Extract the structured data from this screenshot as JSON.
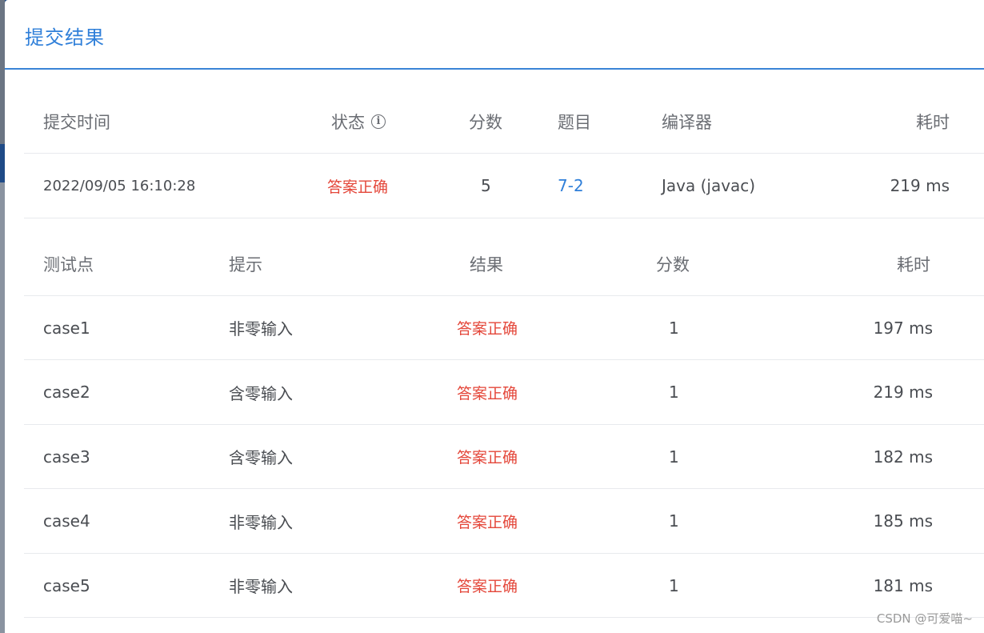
{
  "dialog": {
    "title": "提交结果"
  },
  "submission_table": {
    "headers": {
      "time": "提交时间",
      "status": "状态",
      "score": "分数",
      "problem": "题目",
      "compiler": "编译器",
      "elapsed": "耗时"
    },
    "row": {
      "time": "2022/09/05 16:10:28",
      "status": "答案正确",
      "score": "5",
      "problem": "7-2",
      "compiler": "Java (javac)",
      "elapsed": "219 ms"
    }
  },
  "testcase_table": {
    "headers": {
      "case": "测试点",
      "hint": "提示",
      "result": "结果",
      "score": "分数",
      "elapsed": "耗时"
    },
    "rows": [
      {
        "case": "case1",
        "hint": "非零输入",
        "result": "答案正确",
        "score": "1",
        "elapsed": "197 ms"
      },
      {
        "case": "case2",
        "hint": "含零输入",
        "result": "答案正确",
        "score": "1",
        "elapsed": "219 ms"
      },
      {
        "case": "case3",
        "hint": "含零输入",
        "result": "答案正确",
        "score": "1",
        "elapsed": "182 ms"
      },
      {
        "case": "case4",
        "hint": "非零输入",
        "result": "答案正确",
        "score": "1",
        "elapsed": "185 ms"
      },
      {
        "case": "case5",
        "hint": "非零输入",
        "result": "答案正确",
        "score": "1",
        "elapsed": "181 ms"
      }
    ]
  },
  "icons": {
    "status_info": "info-circle-icon"
  },
  "colors": {
    "accent": "#2f7fd9",
    "success_text": "#e4473a",
    "divider": "#e8eaed"
  },
  "watermark": "CSDN @可爱喵~"
}
